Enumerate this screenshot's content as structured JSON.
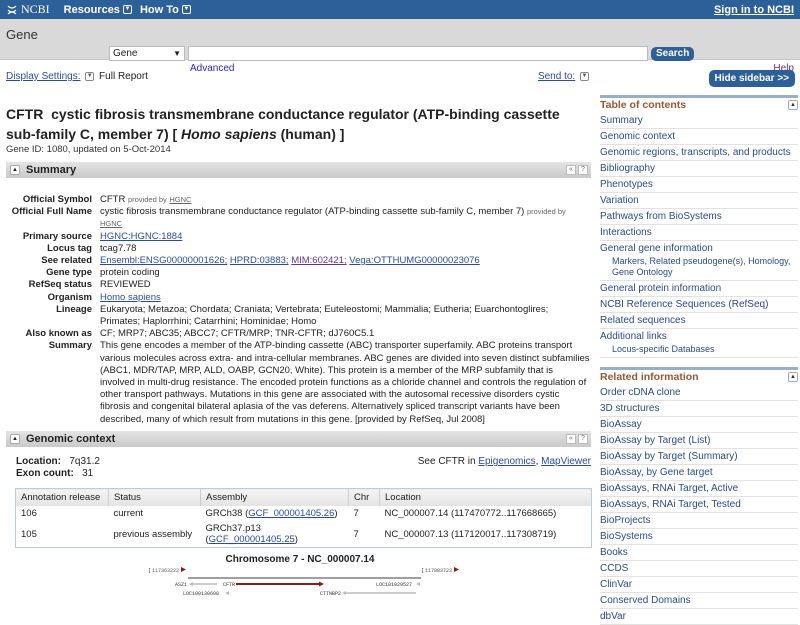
{
  "topbar": {
    "logo": "NCBI",
    "menus": [
      "Resources",
      "How To"
    ],
    "signin": "Sign in to NCBI"
  },
  "search": {
    "db_label": "Gene",
    "db_selected": "Gene",
    "query": "",
    "button": "Search",
    "advanced": "Advanced",
    "help": "Help"
  },
  "page": {
    "display_settings": "Display Settings:",
    "display_value": "Full Report",
    "send_to": "Send to:",
    "title_symbol": "CFTR",
    "title_name": "cystic fibrosis transmembrane conductance regulator (ATP-binding cassette sub-family C, member 7) [",
    "title_species": "Homo sapiens",
    "title_common": "(human) ]",
    "gene_id": "Gene ID: 1080, updated on 5-Oct-2014"
  },
  "summary": {
    "header": "Summary",
    "provided_by": "provided by",
    "hgnc": "HGNC",
    "official_symbol": {
      "k": "Official Symbol",
      "v": "CFTR"
    },
    "official_full_name": {
      "k": "Official Full Name",
      "v": "cystic fibrosis transmembrane conductance regulator (ATP-binding cassette sub-family C, member 7)"
    },
    "primary_source": {
      "k": "Primary source",
      "v": "HGNC:HGNC:1884"
    },
    "locus_tag": {
      "k": "Locus tag",
      "v": "tcag7.78"
    },
    "see_related": {
      "k": "See related",
      "links": [
        "Ensembl:ENSG00000001626;",
        "HPRD:03883;",
        "MIM:602421;",
        "Vega:OTTHUMG00000023076"
      ]
    },
    "gene_type": {
      "k": "Gene type",
      "v": "protein coding"
    },
    "refseq_status": {
      "k": "RefSeq status",
      "v": "REVIEWED"
    },
    "organism": {
      "k": "Organism",
      "v": "Homo sapiens"
    },
    "lineage": {
      "k": "Lineage",
      "v": "Eukaryota; Metazoa; Chordata; Craniata; Vertebrata; Euteleostomi; Mammalia; Eutheria; Euarchontoglires; Primates; Haplorrhini; Catarrhini; Hominidae; Homo"
    },
    "also_known_as": {
      "k": "Also known as",
      "v": "CF; MRP7; ABC35; ABCC7; CFTR/MRP; TNR-CFTR; dJ760C5.1"
    },
    "summary_text": {
      "k": "Summary",
      "v": "This gene encodes a member of the ATP-binding cassette (ABC) transporter superfamily. ABC proteins transport various molecules across extra- and intra-cellular membranes. ABC genes are divided into seven distinct subfamilies (ABC1, MDR/TAP, MRP, ALD, OABP, GCN20, White). This protein is a member of the MRP subfamily that is involved in multi-drug resistance. The encoded protein functions as a chloride channel and controls the regulation of other transport pathways. Mutations in this gene are associated with the autosomal recessive disorders cystic fibrosis and congenital bilateral aplasia of the vas deferens. Alternatively spliced transcript variants have been described, many of which result from mutations in this gene. [provided by RefSeq, Jul 2008]"
    }
  },
  "genomic": {
    "header": "Genomic context",
    "location_label": "Location:",
    "location": "7q31.2",
    "exon_label": "Exon count:",
    "exon_count": "31",
    "see_prefix": "See CFTR in",
    "see_links": [
      "Epigenomics",
      "MapViewer"
    ],
    "columns": [
      "Annotation release",
      "Status",
      "Assembly",
      "Chr",
      "Location"
    ],
    "rows": [
      {
        "release": "106",
        "status": "current",
        "assembly": "GRCh38",
        "acc": "GCF_000001405.26",
        "chr": "7",
        "location": "NC_000007.14 (117470772..117668665)"
      },
      {
        "release": "105",
        "status": "previous assembly",
        "assembly": "GRCh37.p13",
        "acc": "GCF_000001405.25",
        "chr": "7",
        "location": "NC_000007.13 (117120017..117308719)"
      }
    ],
    "chrom_title": "Chromosome 7 - NC_000007.14",
    "left_bound": "117363222",
    "right_bound": "117883723",
    "genes": [
      "ASZ1",
      "CFTR",
      "LOC100130608",
      "CTTNBP2",
      "LOC101929527"
    ]
  },
  "sidebar": {
    "hide": "Hide sidebar >>",
    "toc_title": "Table of contents",
    "toc": [
      {
        "label": "Summary"
      },
      {
        "label": "Genomic context"
      },
      {
        "label": "Genomic regions, transcripts, and products"
      },
      {
        "label": "Bibliography"
      },
      {
        "label": "Phenotypes"
      },
      {
        "label": "Variation"
      },
      {
        "label": "Pathways from BioSystems"
      },
      {
        "label": "Interactions"
      },
      {
        "label": "General gene information",
        "sub": "Markers, Related pseudogene(s), Homology, Gene Ontology"
      },
      {
        "label": "General protein information"
      },
      {
        "label": "NCBI Reference Sequences (RefSeq)"
      },
      {
        "label": "Related sequences"
      },
      {
        "label": "Additional links",
        "sub": "Locus-specific Databases"
      }
    ],
    "related_title": "Related information",
    "related": [
      "Order cDNA clone",
      "3D structures",
      "BioAssay",
      "BioAssay by Target (List)",
      "BioAssay by Target (Summary)",
      "BioAssay, by Gene target",
      "BioAssays, RNAi Target, Active",
      "BioAssays, RNAi Target, Tested",
      "BioProjects",
      "BioSystems",
      "Books",
      "CCDS",
      "ClinVar",
      "Conserved Domains",
      "dbVar"
    ]
  }
}
